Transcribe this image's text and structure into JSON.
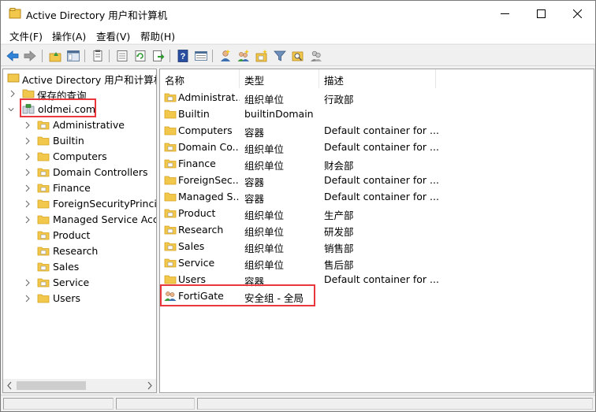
{
  "window": {
    "title": "Active Directory 用户和计算机",
    "controls": [
      "minimize",
      "maximize",
      "close"
    ]
  },
  "menu": [
    "文件(F)",
    "操作(A)",
    "查看(V)",
    "帮助(H)"
  ],
  "toolbar": {
    "buttons": [
      "back-arrow-icon",
      "forward-arrow-icon",
      "up-folder-icon",
      "show-tree-icon",
      "properties-icon",
      "export-list-icon",
      "refresh-icon",
      "export-icon",
      "help-icon",
      "details-view-icon",
      "new-user-icon",
      "new-group-icon",
      "new-ou-icon",
      "filter-icon",
      "find-icon",
      "add-to-group-icon"
    ]
  },
  "tree": {
    "root": "Active Directory 用户和计算机",
    "saved_queries": "保存的查询",
    "domain": "oldmei.com",
    "children": [
      "Administrative",
      "Builtin",
      "Computers",
      "Domain Controllers",
      "Finance",
      "ForeignSecurityPrincipals",
      "Managed Service Accounts",
      "Product",
      "Research",
      "Sales",
      "Service",
      "Users"
    ]
  },
  "list": {
    "columns": [
      "名称",
      "类型",
      "描述"
    ],
    "rows": [
      {
        "name": "Administrat...",
        "type": "组织单位",
        "desc": "行政部",
        "icon": "ou-folder-icon"
      },
      {
        "name": "Builtin",
        "type": "builtinDomain",
        "desc": "",
        "icon": "folder-icon"
      },
      {
        "name": "Computers",
        "type": "容器",
        "desc": "Default container for ...",
        "icon": "folder-icon"
      },
      {
        "name": "Domain Co...",
        "type": "组织单位",
        "desc": "Default container for ...",
        "icon": "ou-folder-icon"
      },
      {
        "name": "Finance",
        "type": "组织单位",
        "desc": "财会部",
        "icon": "ou-folder-icon"
      },
      {
        "name": "ForeignSec...",
        "type": "容器",
        "desc": "Default container for ...",
        "icon": "folder-icon"
      },
      {
        "name": "Managed S...",
        "type": "容器",
        "desc": "Default container for ...",
        "icon": "folder-icon"
      },
      {
        "name": "Product",
        "type": "组织单位",
        "desc": "生产部",
        "icon": "ou-folder-icon"
      },
      {
        "name": "Research",
        "type": "组织单位",
        "desc": "研发部",
        "icon": "ou-folder-icon"
      },
      {
        "name": "Sales",
        "type": "组织单位",
        "desc": "销售部",
        "icon": "ou-folder-icon"
      },
      {
        "name": "Service",
        "type": "组织单位",
        "desc": "售后部",
        "icon": "ou-folder-icon"
      },
      {
        "name": "Users",
        "type": "容器",
        "desc": "Default container for ...",
        "icon": "folder-icon"
      },
      {
        "name": "FortiGate",
        "type": "安全组 - 全局",
        "desc": "",
        "icon": "security-group-icon"
      }
    ]
  },
  "colors": {
    "folder": "#f1c84b",
    "folder_dark": "#d9a21c",
    "highlight": "#e8383d",
    "selection_text": "#000000"
  }
}
